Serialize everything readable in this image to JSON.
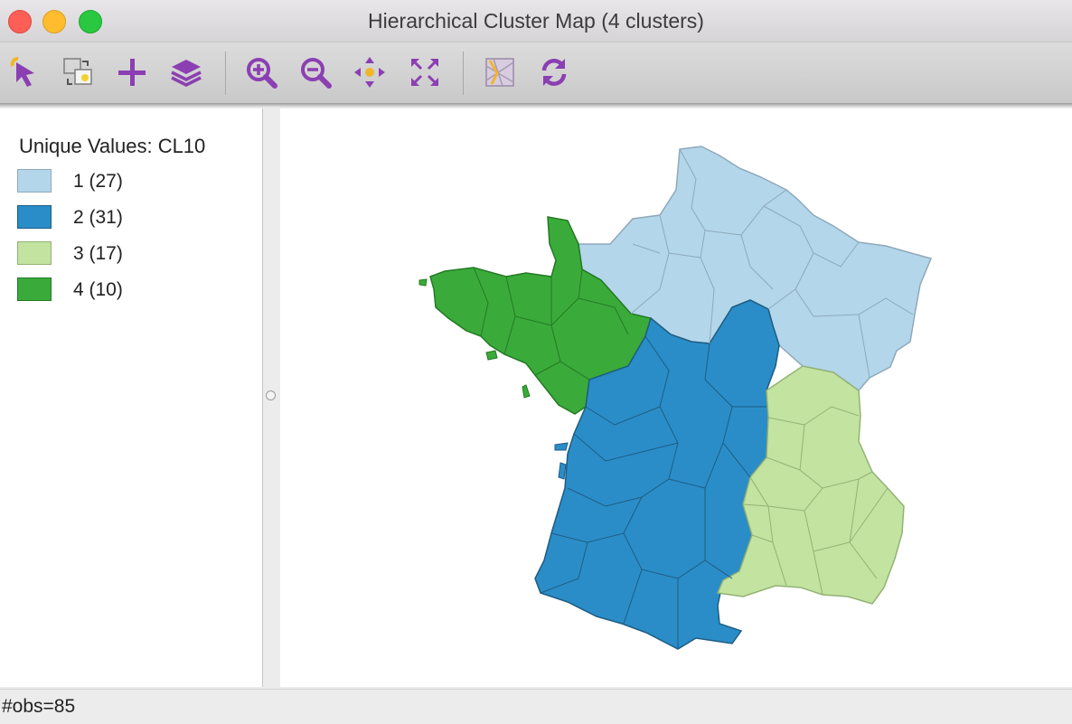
{
  "window": {
    "title": "Hierarchical Cluster Map (4 clusters)"
  },
  "toolbar": {
    "tools": [
      {
        "name": "select-tool",
        "icon": "arrow-pointer-icon"
      },
      {
        "name": "select-mode-tool",
        "icon": "select-mode-icon"
      },
      {
        "name": "add-tool",
        "icon": "plus-icon"
      },
      {
        "name": "layers-tool",
        "icon": "layers-icon"
      },
      {
        "name": "zoom-in-tool",
        "icon": "zoom-in-icon"
      },
      {
        "name": "zoom-out-tool",
        "icon": "zoom-out-icon"
      },
      {
        "name": "pan-tool",
        "icon": "pan-icon"
      },
      {
        "name": "full-extent-tool",
        "icon": "full-extent-icon"
      },
      {
        "name": "basemap-tool",
        "icon": "basemap-icon"
      },
      {
        "name": "refresh-tool",
        "icon": "refresh-icon"
      }
    ],
    "accent_color": "#8b3fb2"
  },
  "legend": {
    "title": "Unique Values: CL10",
    "items": [
      {
        "label": "1 (27)",
        "fill": "#b3d6ea",
        "stroke": "#8fa9bb"
      },
      {
        "label": "2 (31)",
        "fill": "#2a8dc8",
        "stroke": "#1e5d82"
      },
      {
        "label": "3 (17)",
        "fill": "#c3e3a0",
        "stroke": "#93b275"
      },
      {
        "label": "4 (10)",
        "fill": "#3aab3a",
        "stroke": "#237a23"
      }
    ]
  },
  "status": {
    "text": "#obs=85"
  }
}
